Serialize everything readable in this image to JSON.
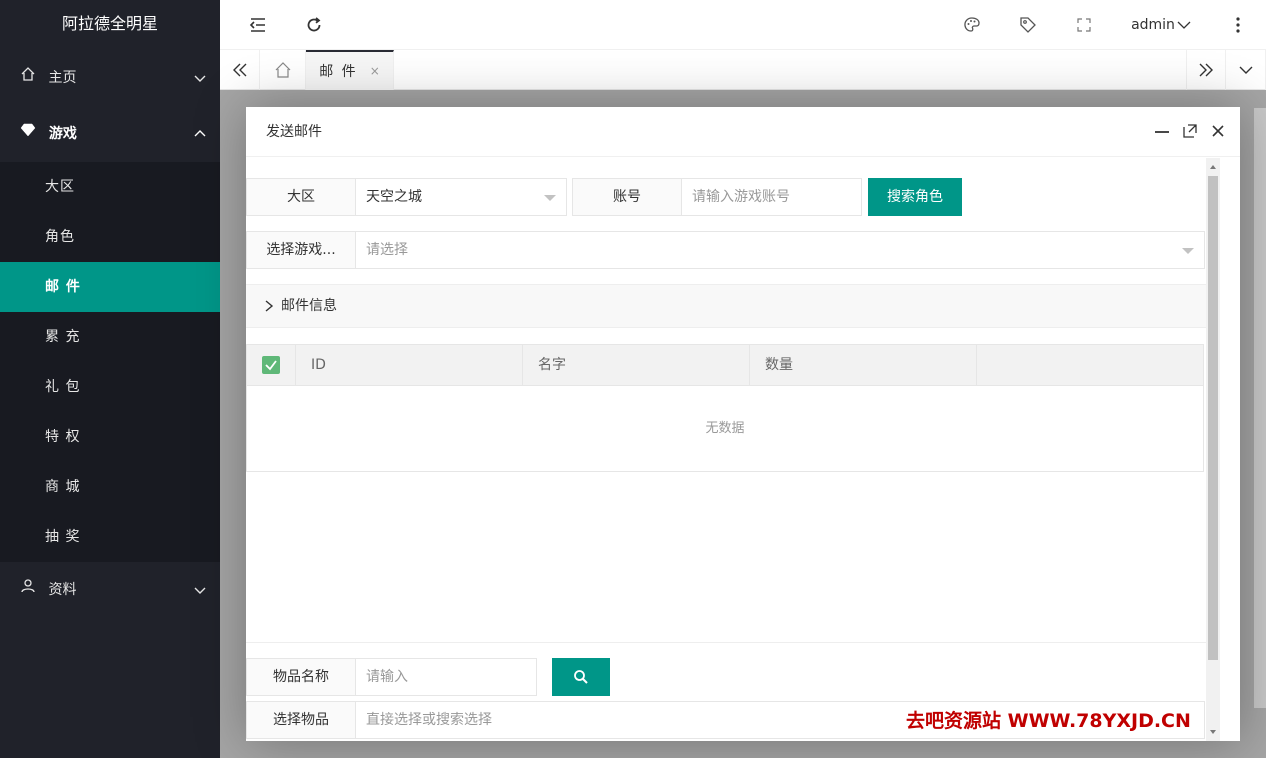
{
  "app": {
    "title": "阿拉德全明星"
  },
  "sidebar": {
    "items": [
      {
        "label": "主页",
        "icon": "home-icon"
      },
      {
        "label": "游戏",
        "icon": "diamond-icon"
      },
      {
        "label": "资料",
        "icon": "user-icon"
      }
    ],
    "game_sub": [
      "大区",
      "角色",
      "邮 件",
      "累 充",
      "礼 包",
      "特 权",
      "商 城",
      "抽 奖"
    ],
    "active_sub": "邮 件"
  },
  "header": {
    "user": "admin"
  },
  "tabs": {
    "active_label": "邮 件",
    "close": "×"
  },
  "modal": {
    "title": "发送邮件",
    "form": {
      "region_label": "大区",
      "region_value": "天空之城",
      "account_label": "账号",
      "account_placeholder": "请输入游戏账号",
      "search_role_button": "搜索角色",
      "select_game_label": "选择游戏...",
      "select_game_placeholder": "请选择"
    },
    "mail_info_label": "邮件信息",
    "table": {
      "columns": [
        "ID",
        "名字",
        "数量"
      ],
      "empty_text": "无数据"
    },
    "item_name_label": "物品名称",
    "item_name_placeholder": "请输入",
    "select_item_label": "选择物品",
    "select_item_placeholder": "直接选择或搜索选择"
  },
  "watermark": "去吧资源站 WWW.78YXJD.CN",
  "colors": {
    "sidebar_bg": "#20222a",
    "accent": "#009688",
    "checkbox": "#5fb878"
  }
}
